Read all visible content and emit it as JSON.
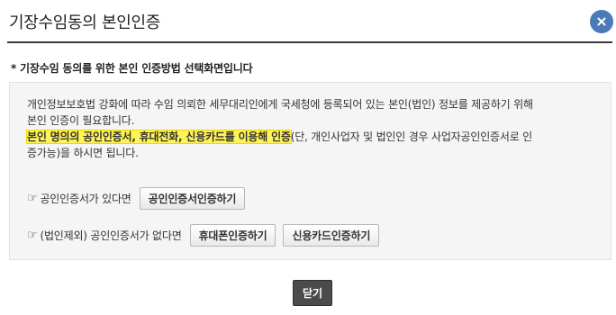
{
  "dialog": {
    "title": "기장수임동의 본인인증",
    "close_icon": "close-icon"
  },
  "subtitle": "* 기장수임 동의를 위한 본인 인증방법 선택화면입니다",
  "description": {
    "line1": "개인정보보호법 강화에 따라 수임 의뢰한 세무대리인에게 국세청에 등록되어 있는 본인(법인) 정보를 제공하기 위해",
    "line2": "본인 인증이 필요합니다.",
    "highlight": "본인 명의의 공인인증서, 휴대전화, 신용카드를 이용해 인증",
    "line3_rest": "(단, 개인사업자 및 법인인 경우 사업자공인인증서로 인",
    "line4": "증가능)을 하시면 됩니다."
  },
  "options": {
    "cert": {
      "hand_icon": "pointing-hand-icon",
      "label": "공인인증서가 있다면",
      "button": "공인인증서인증하기"
    },
    "no_cert": {
      "hand_icon": "pointing-hand-icon",
      "label": "(법인제외) 공인인증서가 없다면",
      "phone_button": "휴대폰인증하기",
      "card_button": "신용카드인증하기"
    }
  },
  "footer": {
    "close_label": "닫기"
  },
  "colors": {
    "accent": "#4a7ab8",
    "highlight": "#fff455",
    "dark_button": "#4b4b4b"
  }
}
